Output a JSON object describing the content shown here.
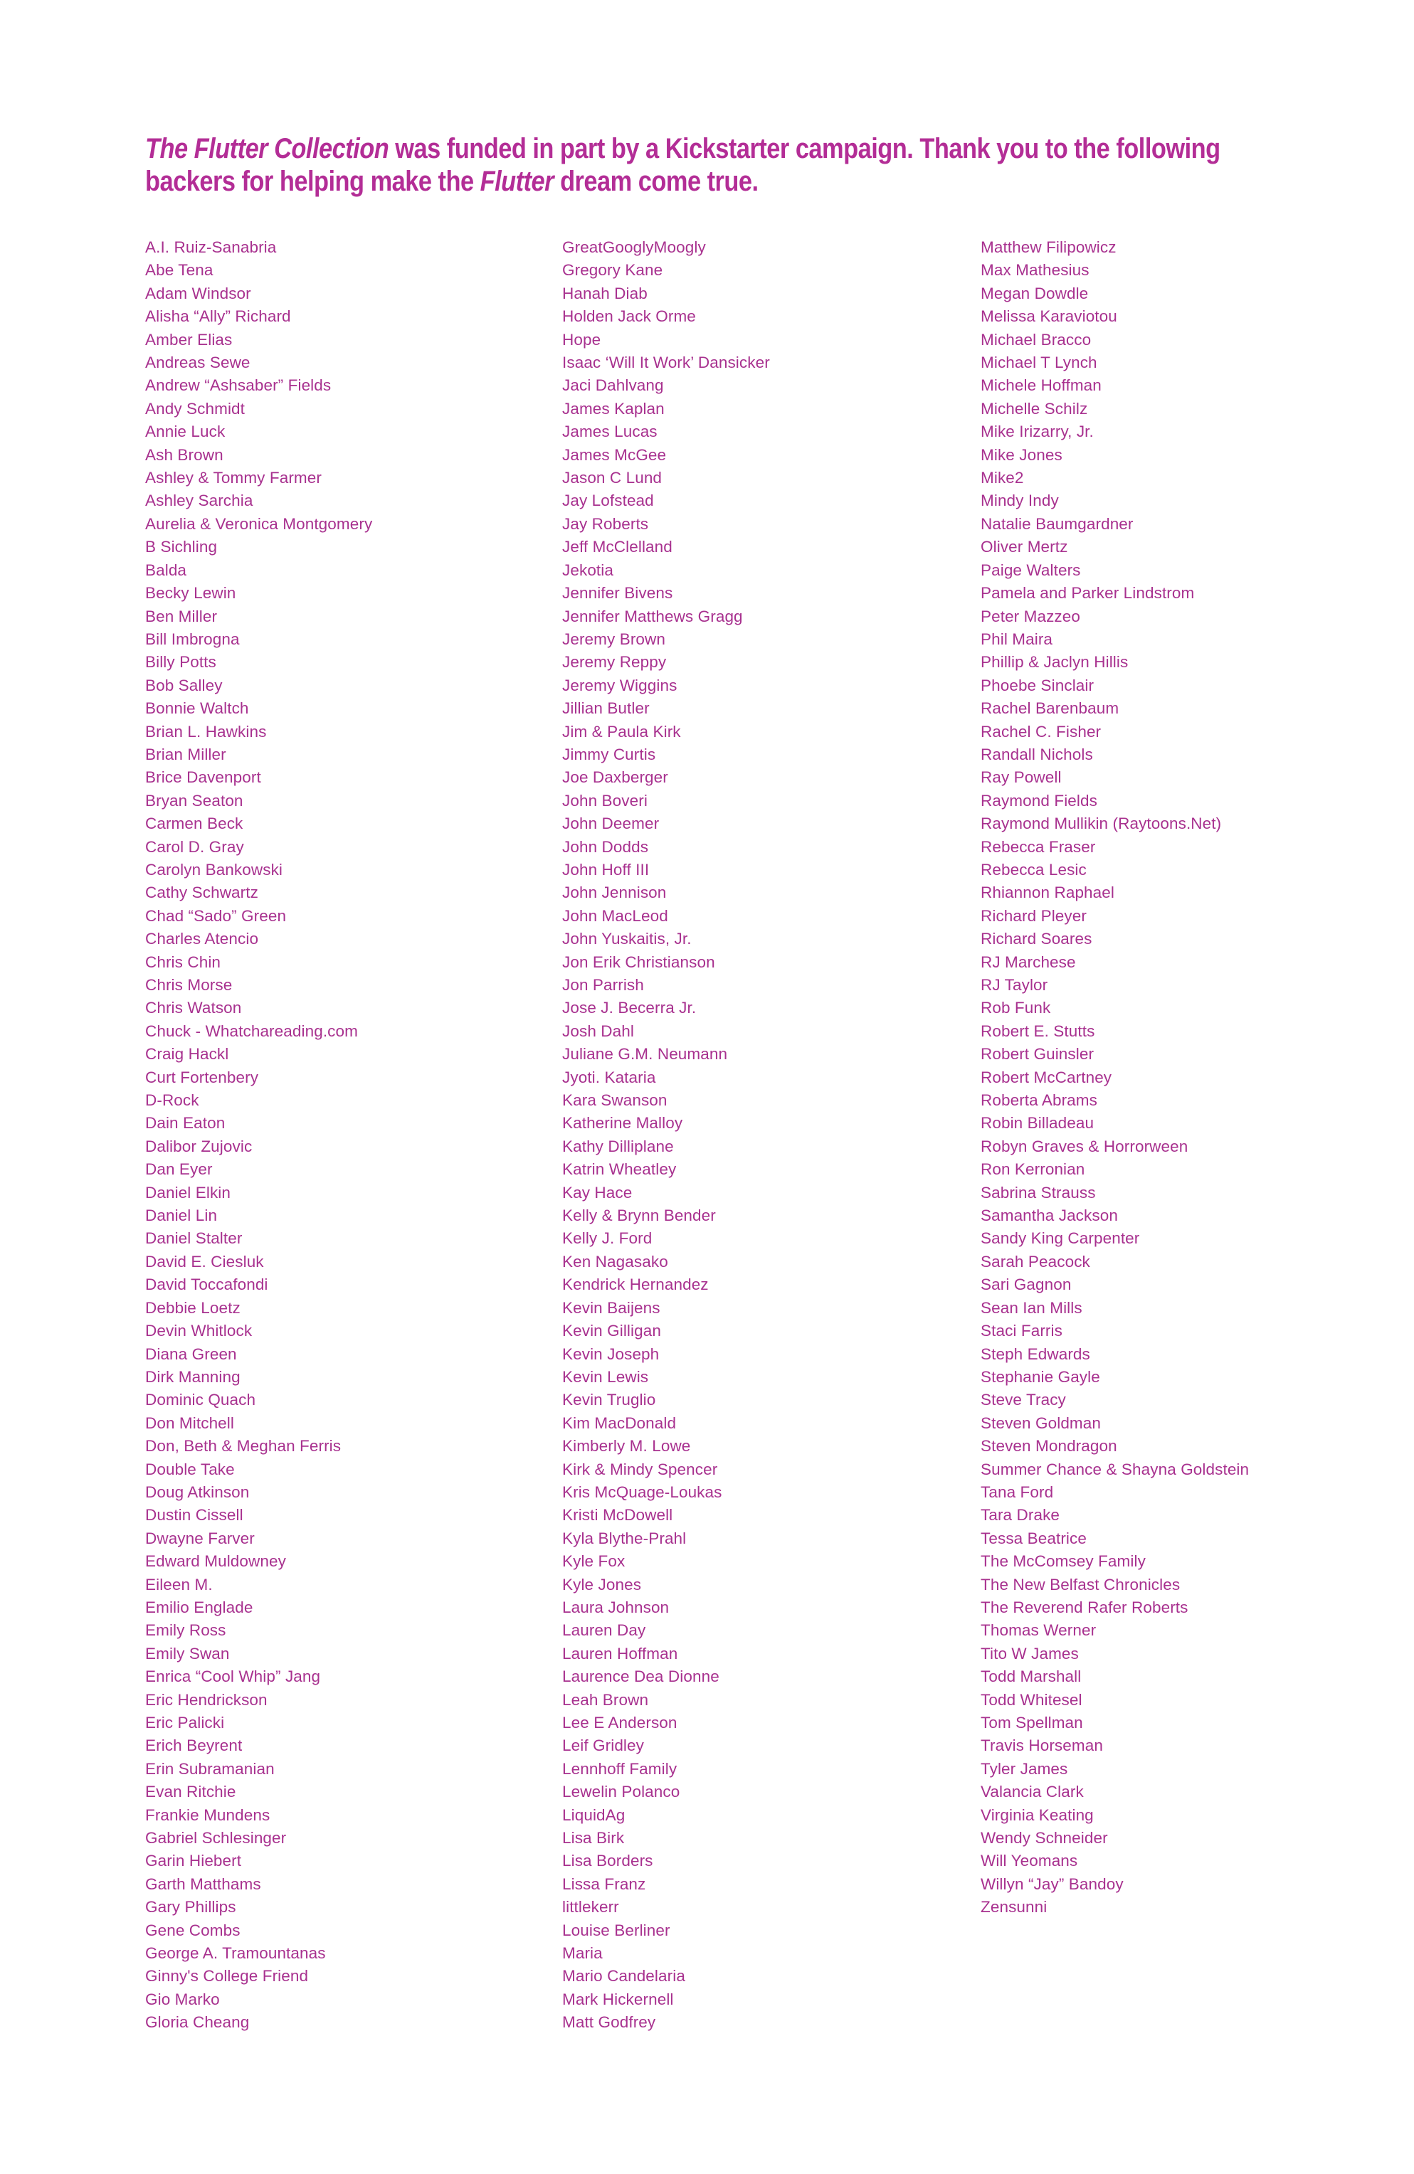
{
  "page": {
    "background_color": "#ffffff",
    "heading_color": "#B32D96",
    "body_color": "#A8318F"
  },
  "heading": {
    "part1_italic": "The Flutter Collection",
    "part2": " was funded in part by a Kickstarter campaign. Thank you to the following backers for helping make the ",
    "part3_italic": "Flutter",
    "part4": " dream come true."
  },
  "backers": {
    "column1": [
      "A.I. Ruiz-Sanabria",
      "Abe Tena",
      "Adam Windsor",
      "Alisha “Ally” Richard",
      "Amber Elias",
      "Andreas Sewe",
      "Andrew “Ashsaber” Fields",
      "Andy Schmidt",
      "Annie Luck",
      "Ash Brown",
      "Ashley & Tommy Farmer",
      "Ashley Sarchia",
      "Aurelia & Veronica Montgomery",
      "B Sichling",
      "Balda",
      "Becky Lewin",
      "Ben Miller",
      "Bill Imbrogna",
      "Billy Potts",
      "Bob Salley",
      "Bonnie Waltch",
      "Brian L. Hawkins",
      "Brian Miller",
      "Brice Davenport",
      "Bryan Seaton",
      "Carmen Beck",
      "Carol D. Gray",
      "Carolyn Bankowski",
      "Cathy Schwartz",
      "Chad “Sado” Green",
      "Charles Atencio",
      "Chris Chin",
      "Chris Morse",
      "Chris Watson",
      "Chuck - Whatchareading.com",
      "Craig Hackl",
      "Curt Fortenbery",
      "D-Rock",
      "Dain Eaton",
      "Dalibor Zujovic",
      "Dan Eyer",
      "Daniel Elkin",
      "Daniel Lin",
      "Daniel Stalter",
      "David E. Ciesluk",
      "David Toccafondi",
      "Debbie Loetz",
      "Devin Whitlock",
      "Diana Green",
      "Dirk Manning",
      "Dominic Quach",
      "Don Mitchell",
      "Don, Beth & Meghan Ferris",
      "Double Take",
      "Doug Atkinson",
      "Dustin Cissell",
      "Dwayne Farver",
      "Edward Muldowney",
      "Eileen M.",
      "Emilio Englade",
      "Emily Ross",
      "Emily Swan",
      "Enrica “Cool Whip” Jang",
      "Eric Hendrickson",
      "Eric Palicki",
      "Erich Beyrent",
      "Erin Subramanian",
      "Evan Ritchie",
      "Frankie Mundens",
      "Gabriel Schlesinger",
      "Garin Hiebert",
      "Garth Matthams",
      "Gary Phillips",
      "Gene Combs",
      "George A. Tramountanas",
      "Ginny's College Friend",
      "Gio Marko",
      "Gloria Cheang"
    ],
    "column2": [
      "GreatGooglyMoogly",
      "Gregory Kane",
      "Hanah Diab",
      "Holden Jack Orme",
      "Hope",
      "Isaac ‘Will It Work’ Dansicker",
      "Jaci Dahlvang",
      "James Kaplan",
      "James Lucas",
      "James McGee",
      "Jason C Lund",
      "Jay Lofstead",
      "Jay Roberts",
      "Jeff McClelland",
      "Jekotia",
      "Jennifer Bivens",
      "Jennifer Matthews Gragg",
      "Jeremy Brown",
      "Jeremy Reppy",
      "Jeremy Wiggins",
      "Jillian Butler",
      "Jim & Paula Kirk",
      "Jimmy Curtis",
      "Joe Daxberger",
      "John Boveri",
      "John Deemer",
      "John Dodds",
      "John Hoff III",
      "John Jennison",
      "John MacLeod",
      "John Yuskaitis, Jr.",
      "Jon Erik Christianson",
      "Jon Parrish",
      "Jose J. Becerra Jr.",
      "Josh Dahl",
      "Juliane G.M. Neumann",
      "Jyoti. Kataria",
      "Kara Swanson",
      "Katherine Malloy",
      "Kathy Dilliplane",
      "Katrin Wheatley",
      "Kay Hace",
      "Kelly & Brynn Bender",
      "Kelly J. Ford",
      "Ken Nagasako",
      "Kendrick Hernandez",
      "Kevin Baijens",
      "Kevin Gilligan",
      "Kevin Joseph",
      "Kevin Lewis",
      "Kevin Truglio",
      "Kim MacDonald",
      "Kimberly M. Lowe",
      "Kirk & Mindy Spencer",
      "Kris McQuage-Loukas",
      "Kristi McDowell",
      "Kyla Blythe-Prahl",
      "Kyle Fox",
      "Kyle Jones",
      "Laura Johnson",
      "Lauren Day",
      "Lauren Hoffman",
      "Laurence Dea Dionne",
      "Leah Brown",
      "Lee E Anderson",
      "Leif Gridley",
      "Lennhoff Family",
      "Lewelin Polanco",
      "LiquidAg",
      "Lisa Birk",
      "Lisa Borders",
      "Lissa Franz",
      "littlekerr",
      "Louise Berliner",
      "Maria",
      "Mario Candelaria",
      "Mark Hickernell",
      "Matt Godfrey"
    ],
    "column3": [
      "Matthew Filipowicz",
      "Max Mathesius",
      "Megan Dowdle",
      "Melissa Karaviotou",
      "Michael Bracco",
      "Michael T Lynch",
      "Michele Hoffman",
      "Michelle Schilz",
      "Mike Irizarry, Jr.",
      "Mike Jones",
      "Mike2",
      "Mindy Indy",
      "Natalie Baumgardner",
      "Oliver Mertz",
      "Paige Walters",
      "Pamela and Parker Lindstrom",
      "Peter Mazzeo",
      "Phil Maira",
      "Phillip & Jaclyn Hillis",
      "Phoebe Sinclair",
      "Rachel Barenbaum",
      "Rachel C. Fisher",
      "Randall Nichols",
      "Ray Powell",
      "Raymond Fields",
      "Raymond Mullikin (Raytoons.Net)",
      "Rebecca Fraser",
      "Rebecca Lesic",
      "Rhiannon Raphael",
      "Richard Pleyer",
      "Richard Soares",
      "RJ Marchese",
      "RJ Taylor",
      "Rob Funk",
      "Robert E. Stutts",
      "Robert Guinsler",
      "Robert McCartney",
      "Roberta Abrams",
      "Robin Billadeau",
      "Robyn Graves & Horrorween",
      "Ron Kerronian",
      "Sabrina Strauss",
      "Samantha Jackson",
      "Sandy King Carpenter",
      "Sarah Peacock",
      "Sari Gagnon",
      "Sean Ian Mills",
      "Staci Farris",
      "Steph Edwards",
      "Stephanie Gayle",
      "Steve Tracy",
      "Steven Goldman",
      "Steven Mondragon",
      "Summer Chance & Shayna Goldstein",
      "Tana Ford",
      "Tara Drake",
      "Tessa Beatrice",
      "The McComsey Family",
      "The New Belfast Chronicles",
      "The Reverend Rafer Roberts",
      "Thomas Werner",
      "Tito W James",
      "Todd Marshall",
      "Todd Whitesel",
      "Tom Spellman",
      "Travis Horseman",
      "Tyler James",
      "Valancia Clark",
      "Virginia Keating",
      "Wendy Schneider",
      "Will Yeomans",
      "Willyn “Jay” Bandoy",
      "Zensunni"
    ]
  }
}
